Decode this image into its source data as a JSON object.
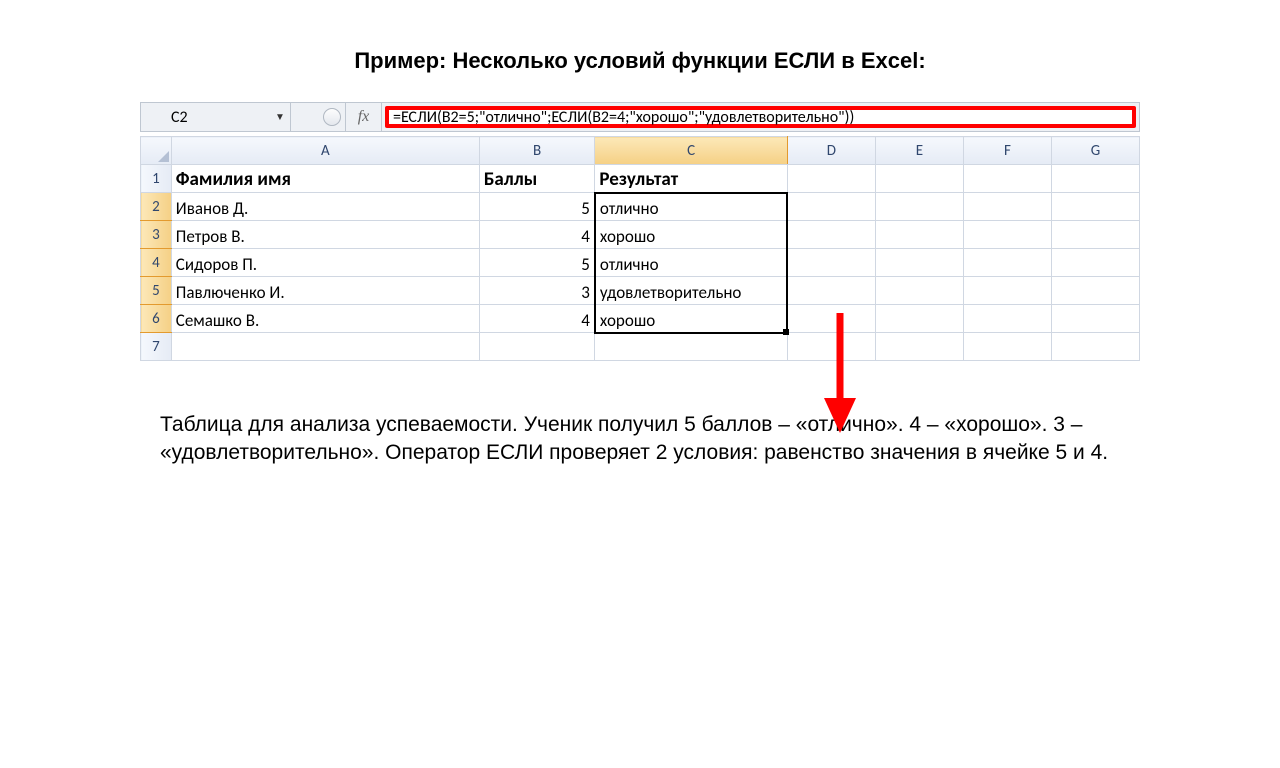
{
  "colors": {
    "highlight_border": "#ff0000",
    "arrow": "#ff0000"
  },
  "title": "Пример: Несколько условий функции ЕСЛИ в Excel:",
  "formula_bar": {
    "name_box": "C2",
    "fx_label": "fx",
    "formula": "=ЕСЛИ(B2=5;\"отлично\";ЕСЛИ(B2=4;\"хорошо\";\"удовлетворительно\"))"
  },
  "columns": [
    "A",
    "B",
    "C",
    "D",
    "E",
    "F",
    "G"
  ],
  "header_row": {
    "A": "Фамилия имя",
    "B": "Баллы",
    "C": "Результат"
  },
  "rows": [
    {
      "num": "1"
    },
    {
      "num": "2",
      "A": "Иванов Д.",
      "B": "5",
      "C": "отлично"
    },
    {
      "num": "3",
      "A": "Петров В.",
      "B": "4",
      "C": "хорошо"
    },
    {
      "num": "4",
      "A": "Сидоров П.",
      "B": "5",
      "C": "отлично"
    },
    {
      "num": "5",
      "A": "Павлюченко И.",
      "B": "3",
      "C": "удовлетворительно"
    },
    {
      "num": "6",
      "A": "Семашко В.",
      "B": "4",
      "C": "хорошо"
    },
    {
      "num": "7"
    }
  ],
  "description": "Таблица для анализа успеваемости. Ученик получил 5 баллов – «отлично». 4 – «хорошо». 3 – «удовлетворительно». Оператор ЕСЛИ проверяет 2 условия: равенство значения в ячейке 5 и 4."
}
